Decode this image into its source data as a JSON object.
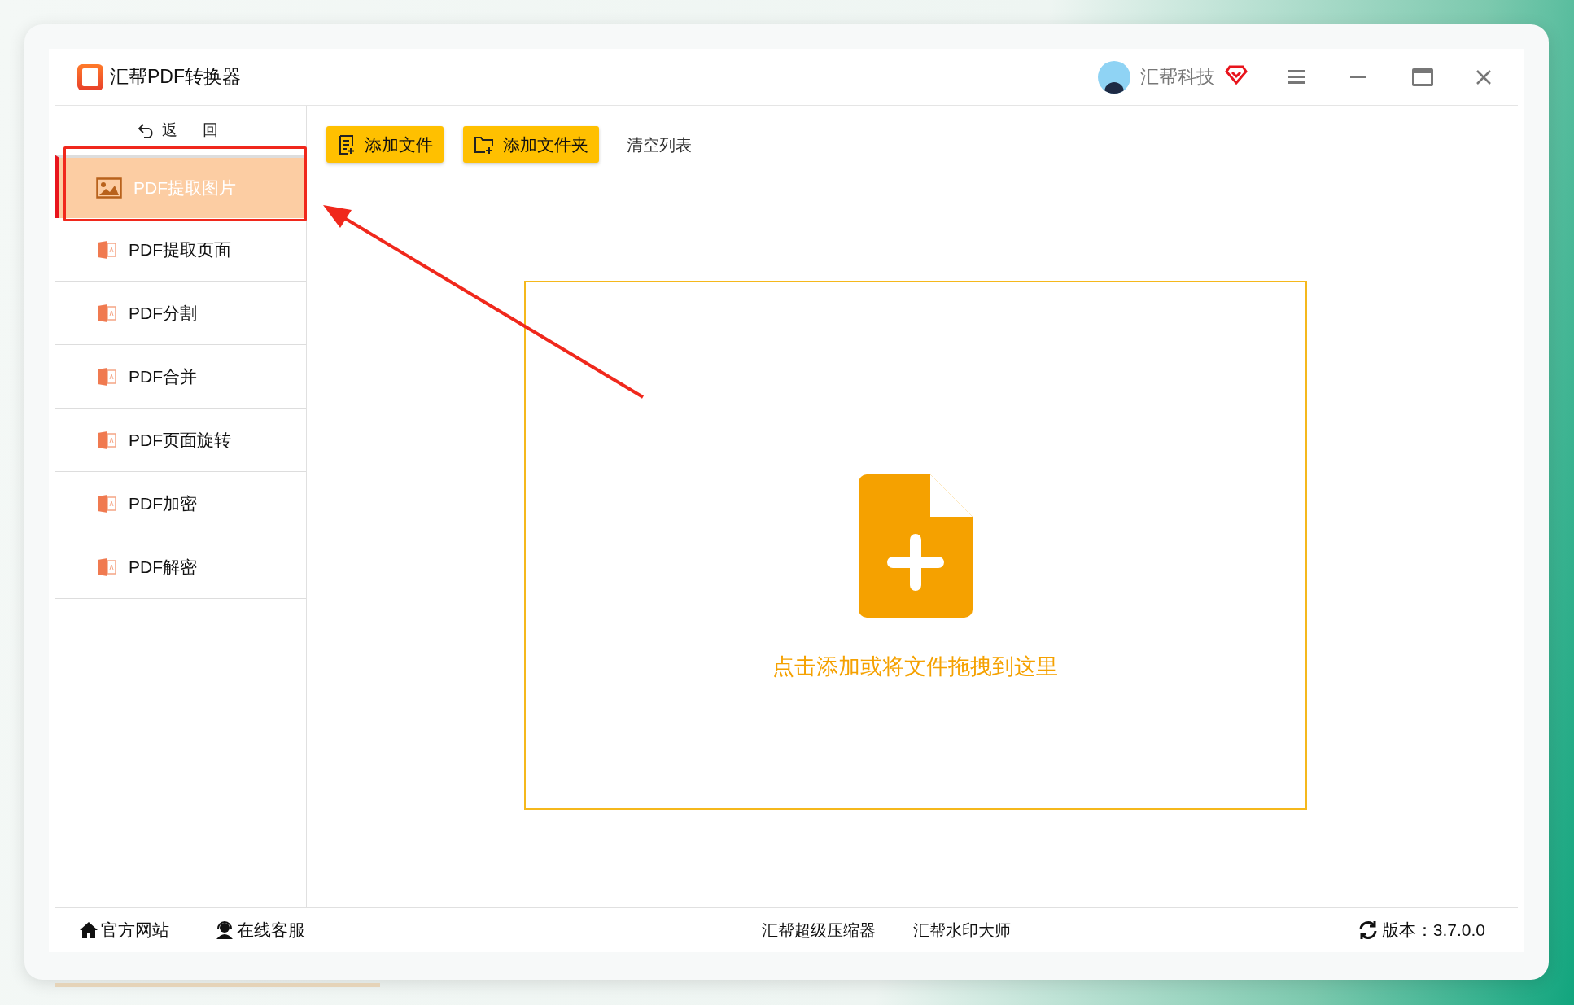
{
  "app": {
    "title": "汇帮PDF转换器",
    "user": "汇帮科技"
  },
  "sidebar": {
    "back": "返　回",
    "items": [
      {
        "label": "PDF提取图片",
        "selected": true
      },
      {
        "label": "PDF提取页面",
        "selected": false
      },
      {
        "label": "PDF分割",
        "selected": false
      },
      {
        "label": "PDF合并",
        "selected": false
      },
      {
        "label": "PDF页面旋转",
        "selected": false
      },
      {
        "label": "PDF加密",
        "selected": false
      },
      {
        "label": "PDF解密",
        "selected": false
      }
    ]
  },
  "toolbar": {
    "buttons": [
      {
        "kind": "file",
        "label": "添加文件"
      },
      {
        "kind": "folder",
        "label": "添加文件夹"
      }
    ],
    "clear": "清空列表"
  },
  "dropzone": {
    "hint": "点击添加或将文件拖拽到这里"
  },
  "footer": {
    "links_left": [
      {
        "kind": "home",
        "label": "官方网站"
      },
      {
        "kind": "support",
        "label": "在线客服"
      }
    ],
    "links_center": [
      "汇帮超级压缩器",
      "汇帮水印大师"
    ],
    "version": "版本：3.7.0.0"
  }
}
